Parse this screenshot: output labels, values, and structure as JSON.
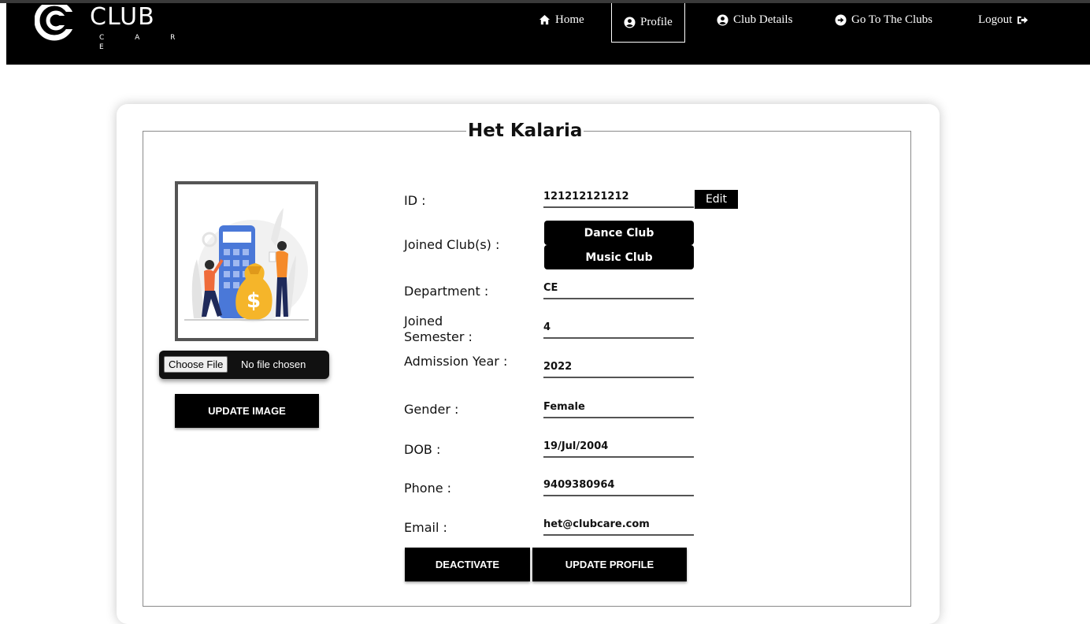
{
  "nav": {
    "logo_title": "CLUB",
    "logo_subtitle": "C A R E",
    "items": [
      {
        "label": "Home",
        "icon": "home-icon"
      },
      {
        "label": "Profile",
        "icon": "user-circle-icon",
        "active": true
      },
      {
        "label": "Club Details",
        "icon": "user-circle-icon"
      },
      {
        "label": "Go To The Clubs",
        "icon": "arrow-circle-right-icon"
      },
      {
        "label": "Logout",
        "icon": "sign-out-icon"
      }
    ]
  },
  "profile": {
    "name": "Het Kalaria",
    "file_input": {
      "button": "Choose File",
      "status": "No file chosen"
    },
    "update_image_label": "UPDATE IMAGE",
    "edit_label": "Edit",
    "fields": {
      "id": {
        "label": "ID :",
        "value": "121212121212"
      },
      "clubs": {
        "label": "Joined Club(s) :",
        "values": [
          "Dance Club",
          "Music Club"
        ]
      },
      "department": {
        "label": "Department :",
        "value": "CE"
      },
      "semester": {
        "label": "Joined Semester :",
        "value": "4"
      },
      "admission_year": {
        "label": "Admission Year :",
        "value": "2022"
      },
      "gender": {
        "label": "Gender :",
        "value": "Female"
      },
      "dob": {
        "label": "DOB :",
        "value": "19/Jul/2004"
      },
      "phone": {
        "label": "Phone :",
        "value": "9409380964"
      },
      "email": {
        "label": "Email :",
        "value": "het@clubcare.com"
      }
    },
    "deactivate_label": "DEACTIVATE",
    "update_profile_label": "UPDATE PROFILE"
  },
  "colors": {
    "navbar": "#000000",
    "button": "#000000",
    "accent_orange": "#f5a623",
    "accent_blue": "#4a6fd6"
  }
}
